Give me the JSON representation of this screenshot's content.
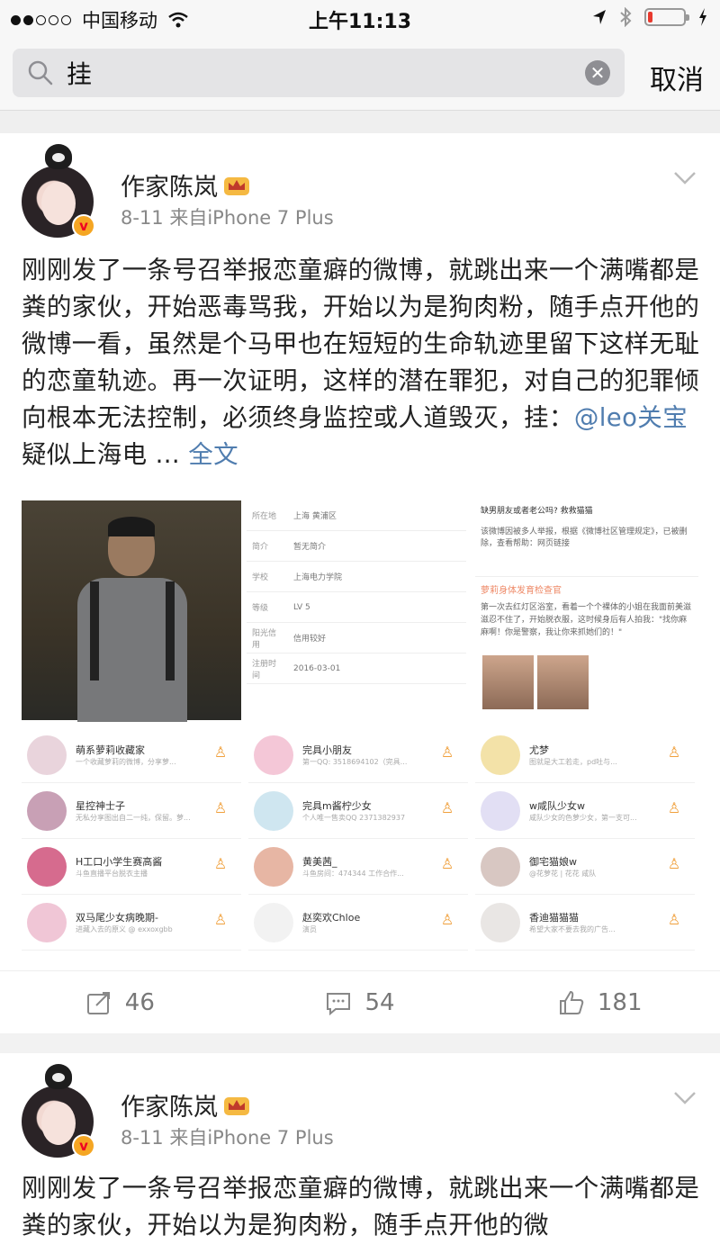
{
  "status_bar": {
    "carrier": "中国移动",
    "time": "上午11:13",
    "battery_level": 0.12
  },
  "search": {
    "query": "挂",
    "cancel_label": "取消"
  },
  "posts": [
    {
      "author": "作家陈岚",
      "meta": "8-11  来自iPhone 7 Plus",
      "text_before": "刚刚发了一条号召举报恋童癖的微博，就跳出来一个满嘴都是粪的家伙，开始恶毒骂我，开始以为是狗肉粉，随手点开他的微博一看，虽然是个马甲也在短短的生命轨迹里留下这样无耻的恋童轨迹。再一次证明，这样的潜在罪犯，对自己的犯罪倾向根本无法控制，必须终身监控或人道毁灭，挂：",
      "mention": "@leo关宝",
      "text_after": " 疑似上海电 ... ",
      "full_text_link": "全文",
      "repost_count": "46",
      "comment_count": "54",
      "like_count": "181"
    },
    {
      "author": "作家陈岚",
      "meta": "8-11  来自iPhone 7 Plus",
      "text_before": "刚刚发了一条号召举报恋童癖的微博，就跳出来一个满嘴都是粪的家伙，开始以为是狗肉粉，随手点开他的微"
    }
  ],
  "screenshot_profile": {
    "rows": [
      {
        "k": "所在地",
        "v": "上海 黄浦区"
      },
      {
        "k": "简介",
        "v": "暂无简介"
      },
      {
        "k": "学校",
        "v": "上海电力学院"
      },
      {
        "k": "等级",
        "v": "LV 5"
      },
      {
        "k": "阳光信用",
        "v": "信用较好"
      },
      {
        "k": "注册时间",
        "v": "2016-03-01"
      }
    ]
  },
  "screenshot_post": {
    "header": "缺男朋友或者老公吗? 救救猫猫",
    "notice": "该微博因被多人举报，根据《微博社区管理规定》，已被删除，查看帮助：网页链接",
    "user": "萝莉身体发育检查官",
    "body": "第一次去红灯区浴室，看着一个个裸体的小姐在我面前美滋滋忍不住了，开始脱衣服，这时候身后有人拍我：\"找你麻麻啊！你是警察，我让你来抓她们的！\""
  },
  "follow_lists": [
    [
      {
        "name": "萌系萝莉收藏家",
        "sub": "一个收藏萝莉的微博，分享萝..."
      },
      {
        "name": "星控神士子",
        "sub": "无私分享图出自二一纯，保留。萝..."
      },
      {
        "name": "H工口小学生赛高酱",
        "sub": "斗鱼直播平台脱衣主播"
      },
      {
        "name": "双马尾少女病晚期-",
        "sub": "进藏入去的原义 @ exxoxgbb"
      }
    ],
    [
      {
        "name": "完具小朋友",
        "sub": "第一QQ: 3518694102（完具..."
      },
      {
        "name": "完具m酱柠少女",
        "sub": "个人唯一售卖QQ 2371382937"
      },
      {
        "name": "黄美茜_",
        "sub": "斗鱼房间：474344 工作合作..."
      },
      {
        "name": "赵奕欢Chloe",
        "sub": "演员"
      }
    ],
    [
      {
        "name": "尤梦",
        "sub": "图就是大工若走，pd吐与..."
      },
      {
        "name": "w咸队少女w",
        "sub": "咸队少女的色萝少女，第一支可..."
      },
      {
        "name": "御宅猫娘w",
        "sub": "@花萝花 | 花花 咸队"
      },
      {
        "name": "香迪猫猫猫",
        "sub": "希望大家不要去我的广告..."
      }
    ]
  ],
  "colors": {
    "link": "#507daf",
    "meta": "#888888",
    "follow_icon": "#f0a03c",
    "badge": "#f5a623"
  }
}
